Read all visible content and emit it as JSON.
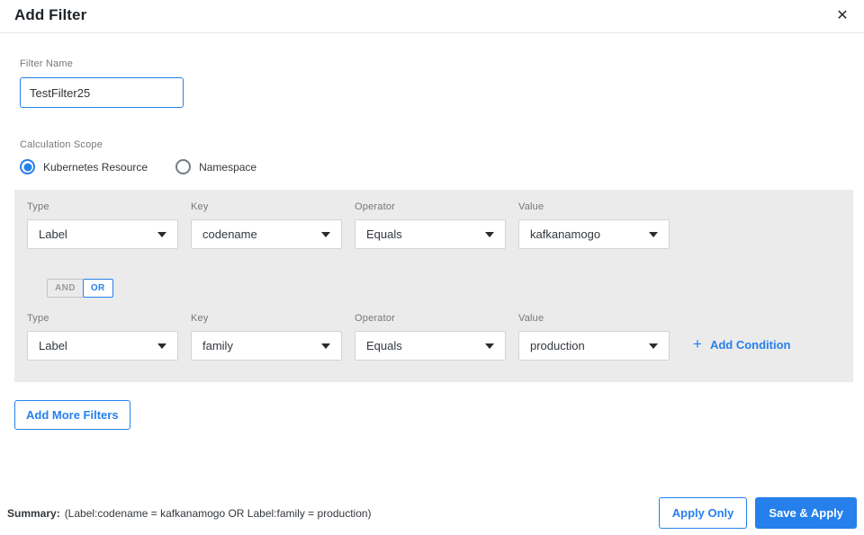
{
  "dialog": {
    "title": "Add Filter",
    "close_icon": "✕"
  },
  "filter_name": {
    "label": "Filter Name",
    "value": "TestFilter25"
  },
  "calculation_scope": {
    "label": "Calculation Scope",
    "options": [
      {
        "label": "Kubernetes Resource",
        "selected": true
      },
      {
        "label": "Namespace",
        "selected": false
      }
    ]
  },
  "conditions": {
    "field_labels": {
      "type": "Type",
      "key": "Key",
      "operator": "Operator",
      "value": "Value"
    },
    "rows": [
      {
        "type": "Label",
        "key": "codename",
        "operator": "Equals",
        "value": "kafkanamogo"
      },
      {
        "type": "Label",
        "key": "family",
        "operator": "Equals",
        "value": "production"
      }
    ],
    "logic_toggle": {
      "and_label": "AND",
      "or_label": "OR",
      "selected": "OR"
    },
    "add_condition": {
      "plus_icon": "+",
      "label": "Add Condition"
    }
  },
  "add_more_filters_label": "Add More Filters",
  "footer": {
    "summary_label": "Summary:",
    "summary_text": "(Label:codename = kafkanamogo OR Label:family = production)",
    "apply_only_label": "Apply Only",
    "save_apply_label": "Save & Apply"
  },
  "colors": {
    "accent": "#2680eb",
    "panel_bg": "#ebebeb"
  }
}
